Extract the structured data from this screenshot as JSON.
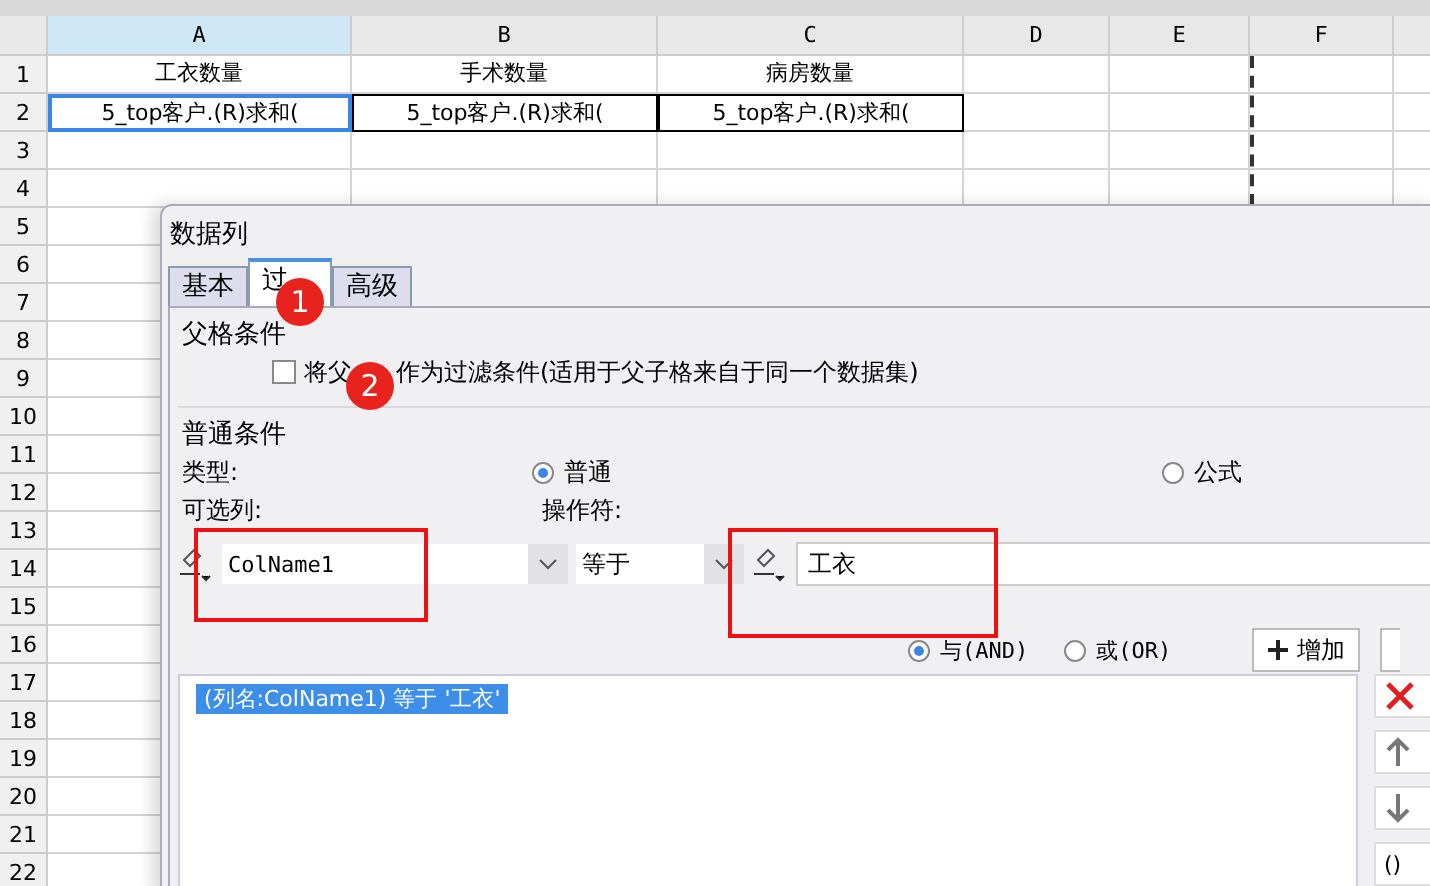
{
  "sheet": {
    "columns": [
      "A",
      "B",
      "C",
      "D",
      "E",
      "F"
    ],
    "rows": [
      {
        "number": "1",
        "cells": [
          "工衣数量",
          "手术数量",
          "病房数量",
          "",
          "",
          ""
        ]
      },
      {
        "number": "2",
        "cells": [
          "5_top客户.(R)求和(",
          "5_top客户.(R)求和(",
          "5_top客户.(R)求和(",
          "",
          "",
          ""
        ]
      },
      {
        "number": "3",
        "cells": []
      },
      {
        "number": "4",
        "cells": []
      },
      {
        "number": "5",
        "cells": []
      },
      {
        "number": "6",
        "cells": []
      },
      {
        "number": "7",
        "cells": []
      },
      {
        "number": "8",
        "cells": []
      },
      {
        "number": "9",
        "cells": []
      },
      {
        "number": "10",
        "cells": []
      },
      {
        "number": "11",
        "cells": []
      },
      {
        "number": "12",
        "cells": []
      },
      {
        "number": "13",
        "cells": []
      },
      {
        "number": "14",
        "cells": []
      },
      {
        "number": "15",
        "cells": []
      },
      {
        "number": "16",
        "cells": []
      },
      {
        "number": "17",
        "cells": []
      },
      {
        "number": "18",
        "cells": []
      },
      {
        "number": "19",
        "cells": []
      },
      {
        "number": "20",
        "cells": []
      },
      {
        "number": "21",
        "cells": []
      },
      {
        "number": "22",
        "cells": []
      }
    ]
  },
  "dialog": {
    "title": "数据列",
    "tabs": [
      {
        "label": "基本",
        "selected": false
      },
      {
        "label": "过",
        "selected": true
      },
      {
        "label": "高级",
        "selected": false
      }
    ],
    "parent_group": {
      "title": "父格条件",
      "checkbox": {
        "label_parts": [
          "将父",
          "作为过滤条件(适用于父子格来自于同一个数据集)"
        ],
        "checked": false
      }
    },
    "normal_group": {
      "title": "普通条件",
      "type_label": "类型:",
      "type_options": [
        {
          "label": "普通",
          "selected": true
        },
        {
          "label": "公式",
          "selected": false
        }
      ],
      "column_label": "可选列:",
      "operator_label": "操作符:",
      "column_value": "ColName1",
      "operator_value": "等于",
      "value": "工衣",
      "logic_options": [
        {
          "label": "与(AND)",
          "selected": true
        },
        {
          "label": "或(OR)",
          "selected": false
        }
      ],
      "add_button": "增加",
      "conditions": [
        {
          "text": "(列名:ColName1) 等于 '工衣'",
          "selected": true
        }
      ],
      "side_button_label": "()"
    }
  },
  "annotations": [
    {
      "label": "1"
    },
    {
      "label": "2"
    }
  ]
}
